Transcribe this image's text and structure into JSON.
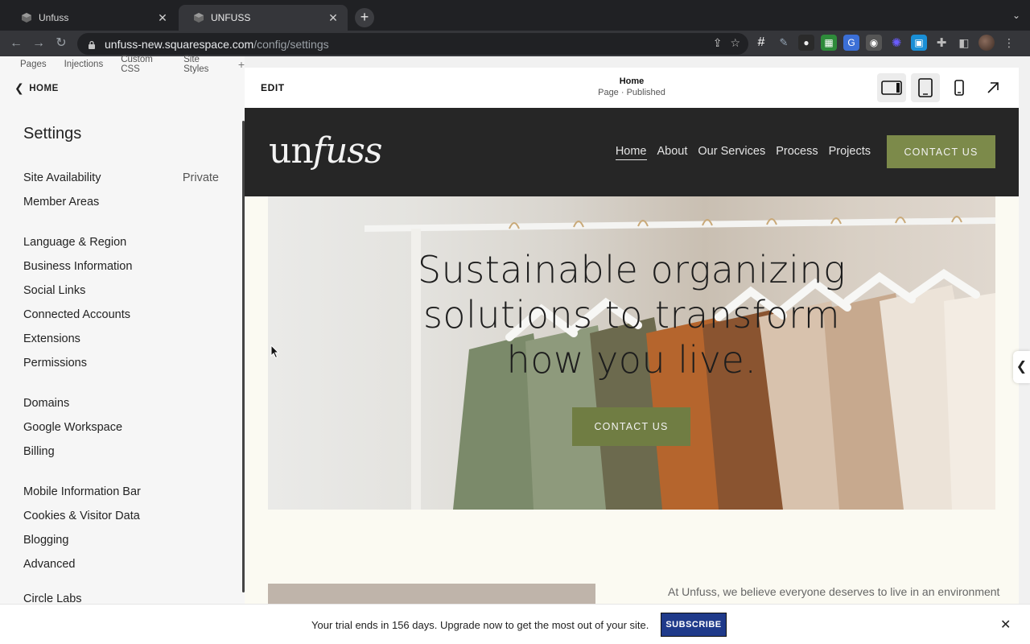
{
  "browser": {
    "tabs": [
      {
        "title": "Unfuss",
        "active": false
      },
      {
        "title": "UNFUSS",
        "active": true
      }
    ],
    "new_tab": "+",
    "url_host": "unfuss-new.squarespace.com",
    "url_path": "/config/settings"
  },
  "panel": {
    "topnav": [
      "Pages",
      "Injections",
      "Custom CSS",
      "Site Styles",
      "+"
    ],
    "back_label": "HOME",
    "title": "Settings",
    "groups": [
      [
        {
          "label": "Site Availability",
          "value": "Private"
        },
        {
          "label": "Member Areas",
          "value": ""
        }
      ],
      [
        {
          "label": "Language & Region",
          "value": ""
        },
        {
          "label": "Business Information",
          "value": ""
        },
        {
          "label": "Social Links",
          "value": ""
        },
        {
          "label": "Connected Accounts",
          "value": ""
        },
        {
          "label": "Extensions",
          "value": ""
        },
        {
          "label": "Permissions",
          "value": ""
        }
      ],
      [
        {
          "label": "Domains",
          "value": ""
        },
        {
          "label": "Google Workspace",
          "value": ""
        },
        {
          "label": "Billing",
          "value": ""
        }
      ],
      [
        {
          "label": "Mobile Information Bar",
          "value": ""
        },
        {
          "label": "Cookies & Visitor Data",
          "value": ""
        },
        {
          "label": "Blogging",
          "value": ""
        },
        {
          "label": "Advanced",
          "value": ""
        }
      ],
      [
        {
          "label": "Circle Labs",
          "value": ""
        }
      ]
    ]
  },
  "preview": {
    "edit_label": "EDIT",
    "page_name": "Home",
    "page_status": "Page · Published",
    "site": {
      "logo_a": "un",
      "logo_b": "fuss",
      "nav": [
        "Home",
        "About",
        "Our Services",
        "Process",
        "Projects"
      ],
      "header_cta": "CONTACT US",
      "hero_title_lines": [
        "Sustainable organizing",
        "solutions to transform",
        "how you live."
      ],
      "hero_cta": "CONTACT US",
      "intro_text": "At Unfuss, we believe everyone deserves to live in an environment"
    }
  },
  "trial": {
    "text": "Your trial ends in 156 days. Upgrade now to get the most out of your site.",
    "subscribe_label": "SUBSCRIBE"
  },
  "colors": {
    "accent_green": "#7c8a4a",
    "header_dark": "#262626",
    "subscribe_blue": "#1f3a8a"
  }
}
